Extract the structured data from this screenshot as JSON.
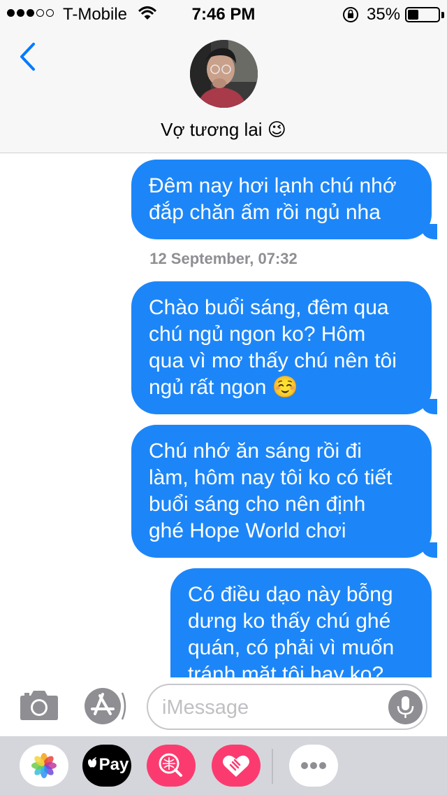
{
  "status_bar": {
    "carrier": "T-Mobile",
    "time": "7:46 PM",
    "battery_percent": "35%",
    "battery_level": 0.35,
    "signal_bars_filled": 3,
    "signal_bars_total": 5
  },
  "header": {
    "contact_name": "Vợ tương lai 😉"
  },
  "messages": [
    {
      "direction": "outgoing",
      "text": "Đêm nay hơi lạnh chú nhớ\nđắp chăn ấm rồi ngủ nha"
    },
    {
      "direction": "outgoing",
      "text": "Chào buổi sáng, đêm qua\nchú ngủ ngon ko? Hôm\nqua vì mơ thấy chú nên tôi\nngủ rất ngon ☺️"
    },
    {
      "direction": "outgoing",
      "text": "Chú nhớ ăn sáng rồi đi\nlàm, hôm nay tôi ko có tiết\nbuổi sáng cho nên định\nghé Hope World chơi"
    },
    {
      "direction": "outgoing",
      "text": "Có điều dạo này bỗng\ndưng ko thấy chú ghé\nquán, có phải vì muốn\ntránh mặt tôi hay ko?"
    }
  ],
  "timestamp": "12 September, 07:32",
  "input": {
    "placeholder": "iMessage",
    "value": ""
  },
  "drawer": {
    "pay_label": "Pay"
  },
  "colors": {
    "bubble": "#1c86f8",
    "accent": "#007aff",
    "timestamp": "#8e8e93",
    "drawer_bg": "#d4d6dc"
  },
  "icons": [
    "signal-icon",
    "wifi-icon",
    "rotation-lock-icon",
    "battery-icon",
    "back-chevron-icon",
    "camera-icon",
    "app-store-icon",
    "microphone-icon",
    "photos-app-icon",
    "apple-pay-app-icon",
    "search-app-icon",
    "digital-touch-app-icon",
    "more-apps-icon"
  ]
}
